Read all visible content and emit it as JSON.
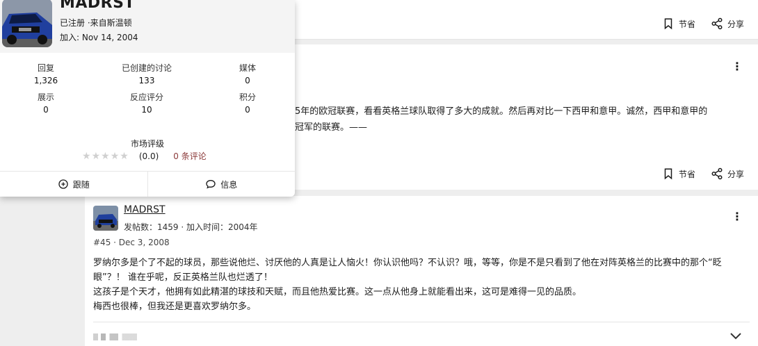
{
  "post_actions": {
    "bookmark_label": "节省",
    "share_label": "分享"
  },
  "partial_post": {
    "line1": "5年的欧冠联赛，看看英格兰球队取得了多大的成就。然后再对比一下西甲和意甲。诚然，西甲和意甲的",
    "line2": "冠军的联赛。——"
  },
  "post": {
    "username": "MADRST",
    "meta": "发帖数：1459 · 加入时间：2004年",
    "number": "#45 · Dec 3, 2008",
    "paragraphs": [
      "罗纳尔多是个了不起的球员，那些说他烂、讨厌他的人真是让人恼火！你认识他吗？不认识？哦，等等，你是不是只看到了他在对阵英格兰的比赛中的那个“眨眼”？！ 谁在乎呢，反正英格兰队也烂透了！",
      "这孩子是个天才，他拥有如此精湛的球技和天赋，而且他热爱比赛。这一点从他身上就能看出来，这可是难得一见的品质。",
      "梅西也很棒，但我还是更喜欢罗纳尔多。"
    ]
  },
  "popup": {
    "username": "MADRST",
    "subtitle": "已注册 ·来自斯温顿",
    "joined": "加入: Nov 14, 2004",
    "stats": [
      {
        "label": "回复",
        "value": "1,326"
      },
      {
        "label": "已创建的讨论",
        "value": "133"
      },
      {
        "label": "媒体",
        "value": "0"
      },
      {
        "label": "展示",
        "value": "0"
      },
      {
        "label": "反应评分",
        "value": "10"
      },
      {
        "label": "积分",
        "value": "0"
      }
    ],
    "market_rating_label": "市场评级",
    "rating_score": "(0.0)",
    "review_count": "0 条评论",
    "stars_filled": 0,
    "stars_total": 5,
    "follow_label": "跟随",
    "info_label": "信息"
  },
  "colors": {
    "review_link": "#8b3a3a",
    "star_empty": "#d0d0d0"
  }
}
